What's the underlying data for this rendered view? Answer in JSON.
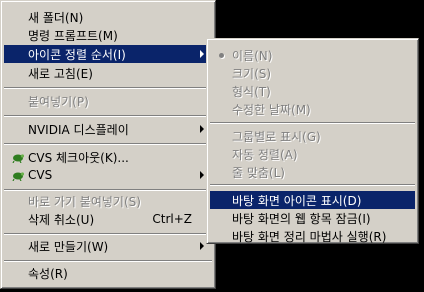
{
  "main_menu": {
    "new_folder": "새 폴더(N)",
    "command_prompt": "명령 프롬프트(M)",
    "arrange_icons": "아이콘 정렬 순서(I)",
    "refresh": "새로 고침(E)",
    "paste": "붙여넣기(P)",
    "nvidia": "NVIDIA 디스플레이",
    "cvs_checkout": "CVS 체크아웃(K)...",
    "cvs": "CVS",
    "paste_shortcut": "바로 가기 붙여넣기(S)",
    "undo_delete": "삭제 취소(U)",
    "undo_shortcut": "Ctrl+Z",
    "new": "새로 만들기(W)",
    "properties": "속성(R)"
  },
  "arrange_submenu": {
    "name": "이름(N)",
    "size": "크기(S)",
    "type": "형식(T)",
    "modified": "수정한 날짜(M)",
    "show_in_groups": "그룹별로 표시(G)",
    "auto_arrange": "자동 정렬(A)",
    "align_to_grid": "줄 맞춤(L)",
    "show_desktop_icons": "바탕 화면 아이콘 표시(D)",
    "lock_web_items": "바탕 화면의 웹 항목 잠금(I)",
    "cleanup_wizard": "바탕 화면 정리 마법사 실행(R)"
  },
  "colors": {
    "menu_bg": "#d4d0c8",
    "highlight": "#0a246a",
    "disabled": "#808080",
    "desktop": "#000000"
  }
}
